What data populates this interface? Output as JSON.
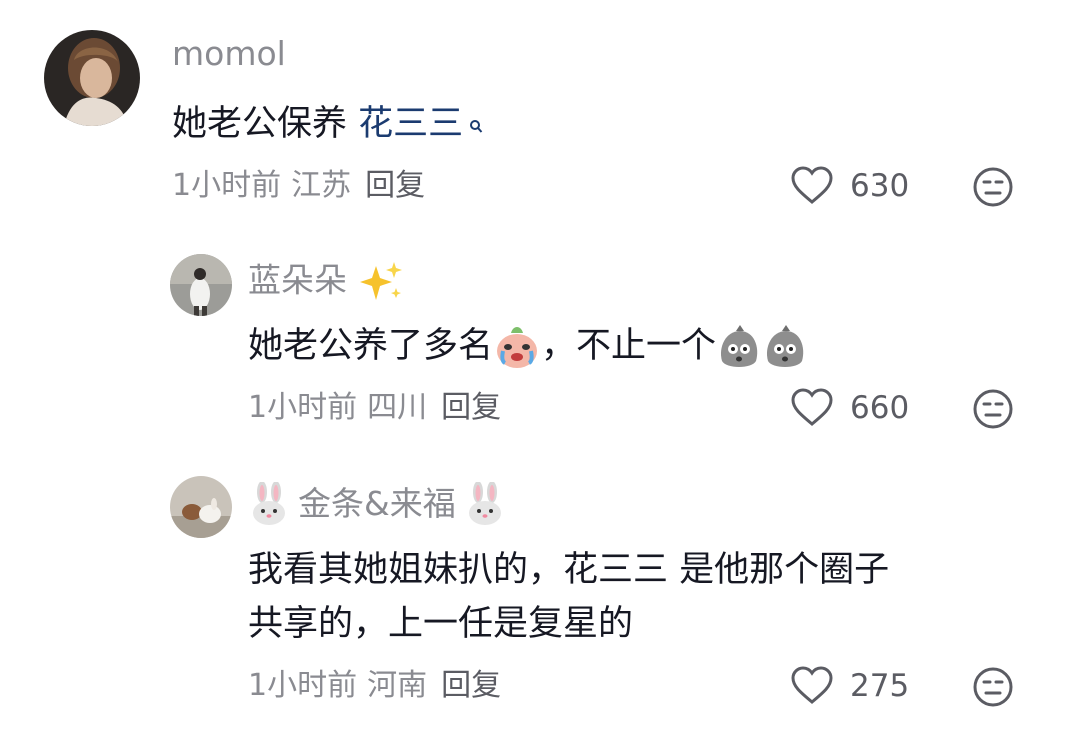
{
  "comments": [
    {
      "username": "momol",
      "text_prefix": "她老公保养 ",
      "link_text": "花三三",
      "time": "1小时前",
      "location": "江苏",
      "reply_label": "回复",
      "likes": "630",
      "icons": {
        "like": "heart-outline-icon",
        "dislike": "meh-face-icon",
        "search": "search-icon"
      }
    },
    {
      "username": "蓝朵朵",
      "text_a": "她老公养了多名",
      "text_b": "，不止一个",
      "time": "1小时前",
      "location": "四川",
      "reply_label": "回复",
      "likes": "660",
      "icons": {
        "badge": "sparkles-icon",
        "crying": "crying-face-emoji",
        "rock": "rock-face-emoji"
      }
    },
    {
      "username": "金条&来福",
      "line1": "我看其她姐妹扒的，花三三 是他那个圈子",
      "line2": "共享的，上一任是复星的",
      "time": "1小时前",
      "location": "河南",
      "reply_label": "回复",
      "likes": "275",
      "icons": {
        "badge": "rabbit-face-icon"
      }
    }
  ]
}
